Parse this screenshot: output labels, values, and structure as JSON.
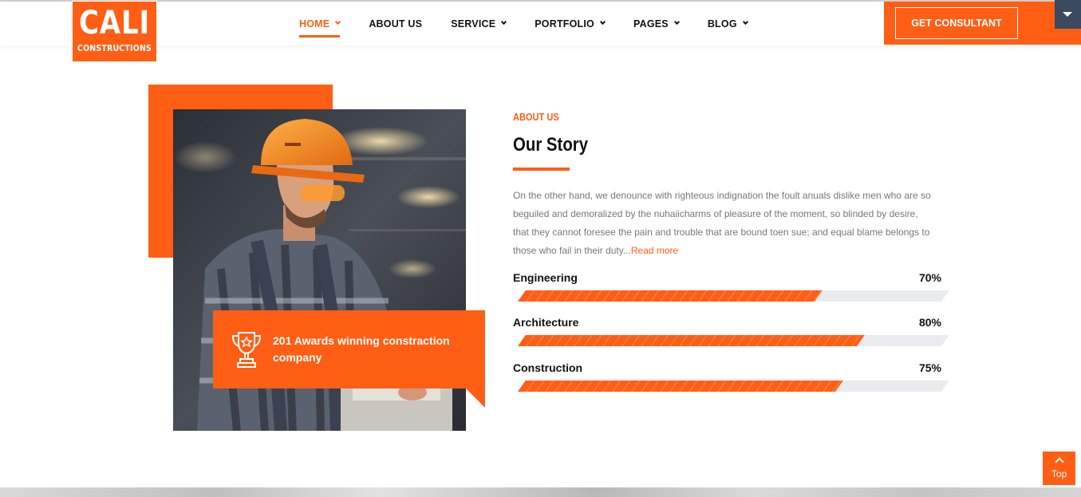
{
  "brand": {
    "logo_main": "CALI",
    "logo_sub": "CONSTRUCTIONS",
    "accent_color": "#ff5e14"
  },
  "nav": {
    "items": [
      {
        "label": "HOME",
        "has_dropdown": true,
        "active": true
      },
      {
        "label": "ABOUT US",
        "has_dropdown": false,
        "active": false
      },
      {
        "label": "SERVICE",
        "has_dropdown": true,
        "active": false
      },
      {
        "label": "PORTFOLIO",
        "has_dropdown": true,
        "active": false
      },
      {
        "label": "PAGES",
        "has_dropdown": true,
        "active": false
      },
      {
        "label": "BLOG",
        "has_dropdown": true,
        "active": false
      }
    ],
    "cta_label": "GET CONSULTANT"
  },
  "about": {
    "eyebrow": "ABOUT US",
    "title": "Our Story",
    "body": "On the other hand, we denounce with righteous indignation the foult anuals dislike men who are so beguiled and demoralized by the nuhaiicharms of pleasure of the moment, so blinded by desire, that they cannot foresee the pain and trouble that are bound toen sue; and equal blame belongs to those who fail in their duty...",
    "read_more": "Read more",
    "award_text": "201 Awards winning constraction company",
    "skills": [
      {
        "name": "Engineering",
        "percent_label": "70%",
        "value": 70
      },
      {
        "name": "Architecture",
        "percent_label": "80%",
        "value": 80
      },
      {
        "name": "Construction",
        "percent_label": "75%",
        "value": 75
      }
    ]
  },
  "back_to_top": {
    "label": "Top"
  },
  "icons": {
    "nav_chevron": "chevron-down-icon",
    "award": "trophy-icon",
    "back_to_top": "arrow-up-icon",
    "corner_toggle": "caret-down-icon"
  }
}
